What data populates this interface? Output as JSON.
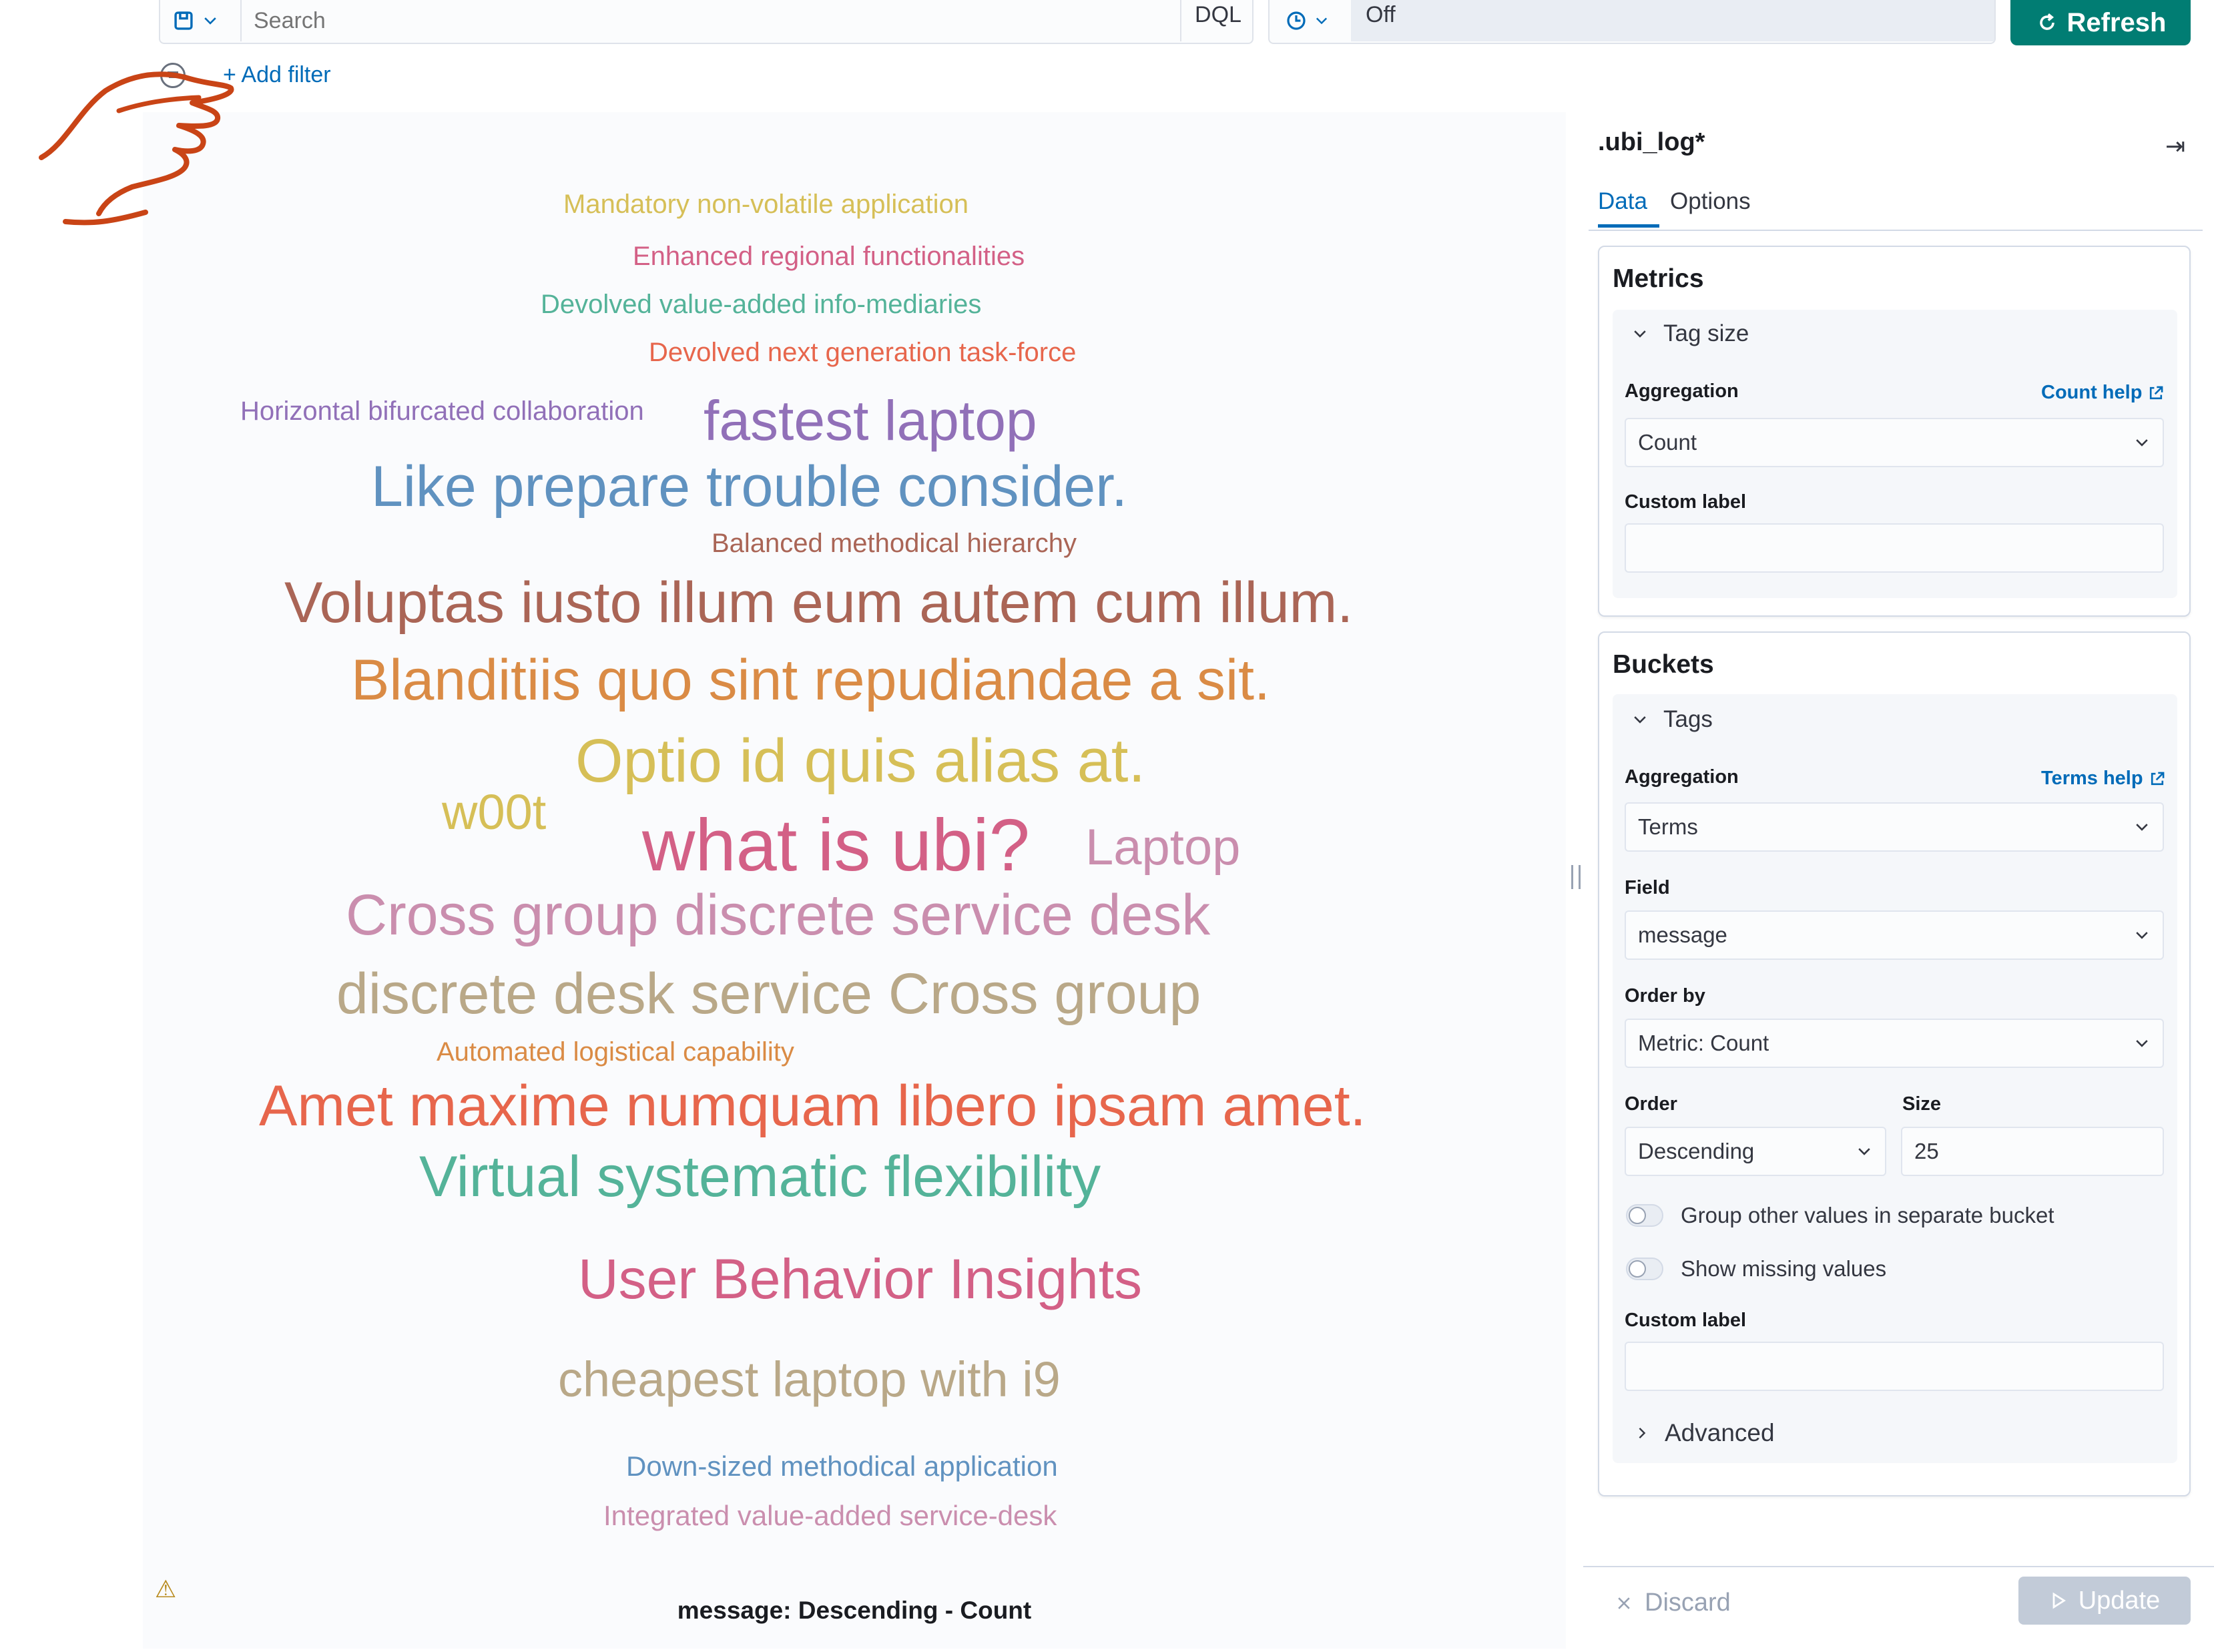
{
  "query_bar": {
    "search_placeholder": "Search",
    "language": "DQL",
    "refresh_interval": "Off",
    "refresh_label": "Refresh"
  },
  "filters": {
    "add_filter_label": "+ Add filter"
  },
  "viz": {
    "caption": "message: Descending - Count",
    "words": [
      {
        "text": "Mandatory non-volatile application",
        "color": "#d6bf57"
      },
      {
        "text": "Enhanced regional functionalities",
        "color": "#d36086"
      },
      {
        "text": "Devolved value-added info-mediaries",
        "color": "#54b399"
      },
      {
        "text": "Devolved next generation task-force",
        "color": "#e7664c"
      },
      {
        "text": "Horizontal bifurcated collaboration",
        "color": "#9170b8"
      },
      {
        "text": "fastest laptop",
        "color": "#9170b8"
      },
      {
        "text": "Like prepare trouble consider.",
        "color": "#6092c0"
      },
      {
        "text": "Balanced methodical hierarchy",
        "color": "#aa6556"
      },
      {
        "text": "Voluptas iusto illum eum autem cum illum.",
        "color": "#aa6556"
      },
      {
        "text": "Blanditiis quo sint repudiandae a sit.",
        "color": "#da8b45"
      },
      {
        "text": "Optio id quis alias at.",
        "color": "#d6bf57"
      },
      {
        "text": "w00t",
        "color": "#d6bf57"
      },
      {
        "text": "what is ubi?",
        "color": "#d36086"
      },
      {
        "text": "Laptop",
        "color": "#ca8eae"
      },
      {
        "text": "Cross group discrete service desk",
        "color": "#ca8eae"
      },
      {
        "text": "discrete desk service Cross group",
        "color": "#b9a888"
      },
      {
        "text": "Automated logistical capability",
        "color": "#da8b45"
      },
      {
        "text": "Amet maxime numquam libero ipsam amet.",
        "color": "#e7664c"
      },
      {
        "text": "Virtual systematic flexibility",
        "color": "#54b399"
      },
      {
        "text": "User Behavior Insights",
        "color": "#d36086"
      },
      {
        "text": "cheapest laptop with i9",
        "color": "#b9a888"
      },
      {
        "text": "Down-sized methodical application",
        "color": "#6092c0"
      },
      {
        "text": "Integrated value-added service-desk",
        "color": "#ca8eae"
      }
    ]
  },
  "sidebar": {
    "index_pattern": ".ubi_log*",
    "tabs": [
      "Data",
      "Options"
    ],
    "metrics": {
      "title": "Metrics",
      "group_title": "Tag size",
      "aggregation_label": "Aggregation",
      "help_link": "Count help",
      "aggregation_value": "Count",
      "custom_label": "Custom label",
      "custom_value": ""
    },
    "buckets": {
      "title": "Buckets",
      "group_title": "Tags",
      "aggregation_label": "Aggregation",
      "help_link": "Terms help",
      "aggregation_value": "Terms",
      "field_label": "Field",
      "field_value": "message",
      "order_by_label": "Order by",
      "order_by_value": "Metric: Count",
      "order_label": "Order",
      "order_value": "Descending",
      "size_label": "Size",
      "size_value": "25",
      "group_other_label": "Group other values in separate bucket",
      "group_other_on": false,
      "show_missing_label": "Show missing values",
      "show_missing_on": false,
      "custom_label": "Custom label",
      "custom_value": "",
      "advanced_label": "Advanced"
    },
    "footer": {
      "discard_label": "Discard",
      "update_label": "Update"
    }
  },
  "colors": {
    "accent": "#017d73",
    "link": "#006bb8",
    "annotation": "#c94416"
  }
}
